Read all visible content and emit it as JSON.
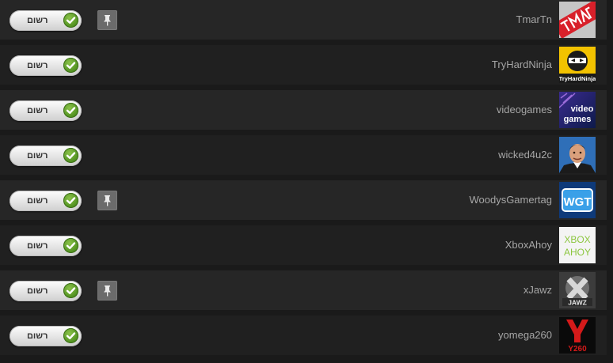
{
  "subscribe_label": "רשום",
  "colors": {
    "row_dark": "#202020",
    "row_light": "#262626",
    "check_green": "#4e8f1e",
    "pin_gray": "#6b6b6b",
    "name_text": "#a6a6a6"
  },
  "channels": [
    {
      "name": "TmarTn",
      "pinned": true,
      "avatar": "tmartn-logo"
    },
    {
      "name": "TryHardNinja",
      "pinned": false,
      "avatar": "tryhardninja-logo",
      "avatar_text": "TryHardNinja"
    },
    {
      "name": "videogames",
      "pinned": false,
      "avatar": "videogames-logo",
      "avatar_text": "video games"
    },
    {
      "name": "wicked4u2c",
      "pinned": false,
      "avatar": "wicked4u2c-photo"
    },
    {
      "name": "WoodysGamertag",
      "pinned": true,
      "avatar": "wgt-logo",
      "avatar_text": "WGT"
    },
    {
      "name": "XboxAhoy",
      "pinned": false,
      "avatar": "xboxahoy-logo",
      "avatar_text": "XBOX AHOY"
    },
    {
      "name": "xJawz",
      "pinned": true,
      "avatar": "xjawz-logo",
      "avatar_text": "X JAWZ"
    },
    {
      "name": "yomega260",
      "pinned": false,
      "avatar": "yomega260-logo",
      "avatar_text": "Y260"
    }
  ]
}
